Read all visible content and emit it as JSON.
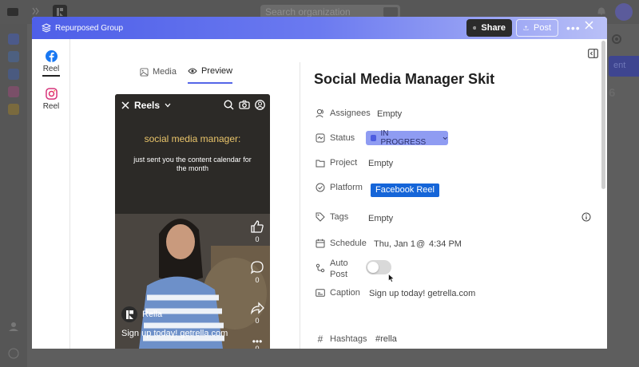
{
  "background": {
    "search_placeholder": "Search organization",
    "right_button": "ent",
    "right_number": "6"
  },
  "header": {
    "group_title": "Repurposed Group",
    "share_label": "Share",
    "post_label": "Post",
    "gradient_colors": [
      "#4e5fe8",
      "#b9c0f7"
    ]
  },
  "rail": {
    "items": [
      {
        "label": "Reel",
        "icon": "facebook-icon",
        "active": true
      },
      {
        "label": "Reel",
        "icon": "instagram-icon",
        "active": false
      }
    ]
  },
  "preview": {
    "tabs": [
      {
        "label": "Media",
        "icon": "image-icon",
        "active": false
      },
      {
        "label": "Preview",
        "icon": "eye-icon",
        "active": true
      }
    ],
    "reels_title": "Reels",
    "overlay_title": "social media manager:",
    "overlay_sub": "just sent you the content calendar for the month",
    "counts": {
      "likes": "0",
      "comments": "0",
      "shares": "0",
      "more": "0"
    },
    "author": "Rella",
    "caption": "Sign up today! getrella.com"
  },
  "details": {
    "title": "Social Media Manager Skit",
    "assignees_label": "Assignees",
    "assignees_value": "Empty",
    "status_label": "Status",
    "status_value": "IN PROGRESS",
    "status_color": "#8f9cf2",
    "project_label": "Project",
    "project_value": "Empty",
    "platform_label": "Platform",
    "platform_value": "Facebook Reel",
    "platform_color": "#1565d8",
    "tags_label": "Tags",
    "tags_value": "Empty",
    "schedule_label": "Schedule",
    "schedule_date": "Thu, Jan 1",
    "schedule_at": "@",
    "schedule_time": "4:34 PM",
    "autopost_label_1": "Auto",
    "autopost_label_2": "Post",
    "autopost_on": false,
    "caption_label": "Caption",
    "caption_value": "Sign up today! getrella.com",
    "hashtags_label": "Hashtags",
    "hashtags_value": "#rella"
  }
}
